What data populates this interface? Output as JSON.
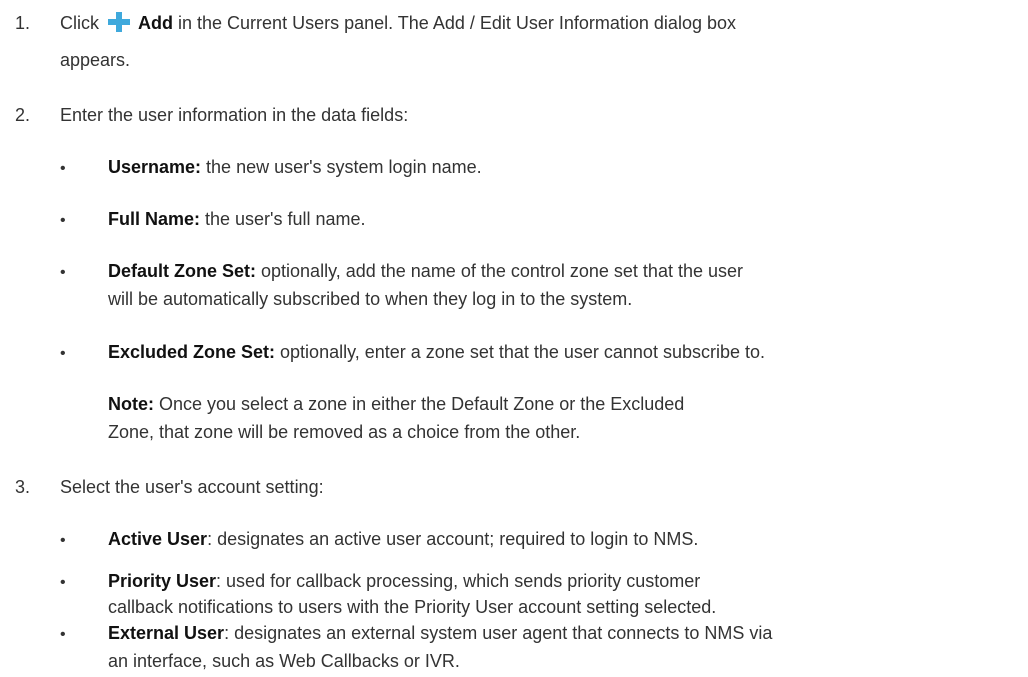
{
  "steps": [
    {
      "number": "1.",
      "pre": "Click",
      "icon": "plus-icon",
      "bold": "Add",
      "text_line1": " in the Current Users panel. The Add / Edit User Information dialog box",
      "text_line2": "appears."
    },
    {
      "number": "2.",
      "text": "Enter the user information in the data fields:",
      "bullets": [
        {
          "bold": "Username:",
          "text": " the new user's system login name."
        },
        {
          "bold": "Full Name:",
          "text": " the user's full name."
        },
        {
          "bold": "Default Zone Set:",
          "text_line1": " optionally, add the name of the control zone set that the user",
          "text_line2": "will be automatically subscribed to when they log in to the system."
        },
        {
          "bold": "Excluded Zone Set:",
          "text": " optionally, enter a zone set that the user cannot subscribe to."
        }
      ],
      "note": {
        "bold": "Note:",
        "text_line1": " Once you select a zone in either the Default Zone or the Excluded",
        "text_line2": "Zone, that zone will be removed as a choice from the other."
      }
    },
    {
      "number": "3.",
      "text": "Select the user's account setting:",
      "bullets": [
        {
          "bold": "Active User",
          "text": ": designates an active user account; required to login to NMS."
        },
        {
          "bold": "Priority User",
          "text_line1": ": used for callback processing, which sends priority customer",
          "text_line2": "callback notifications to users with the Priority User account setting selected."
        },
        {
          "bold": "External User",
          "text_line1": ": designates an external system user agent that connects to NMS via",
          "text_line2": "an interface, such as Web Callbacks or IVR."
        }
      ]
    }
  ],
  "bullet_char": "•",
  "colors": {
    "text": "#333333",
    "bold": "#111111",
    "icon_accent": "#3fa9dc"
  }
}
